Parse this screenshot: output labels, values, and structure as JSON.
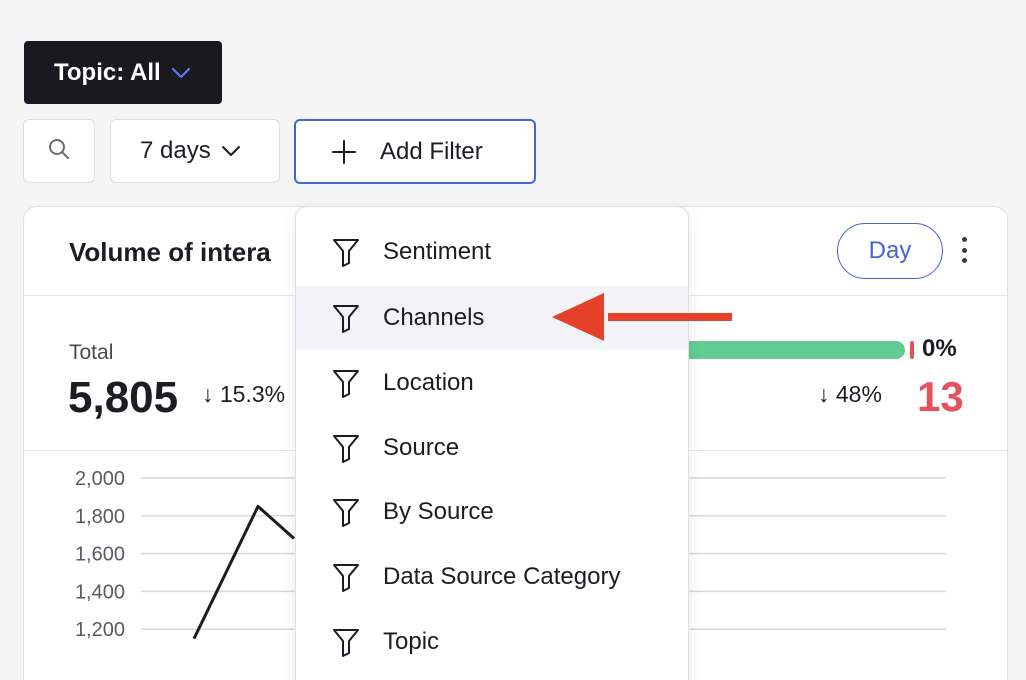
{
  "toolbar": {
    "topic_label": "Topic: All",
    "days_label": "7 days",
    "add_filter_label": "Add Filter"
  },
  "card": {
    "title": "Volume of intera",
    "period_button": "Day",
    "total_label": "Total",
    "total_value": "5,805",
    "total_change": "↓  15.3%",
    "sentiment_percent": "0%",
    "negative_change": "↓  48%",
    "negative_value": "13"
  },
  "filter_menu": {
    "items": [
      {
        "label": "Sentiment"
      },
      {
        "label": "Channels"
      },
      {
        "label": "Location"
      },
      {
        "label": "Source"
      },
      {
        "label": "By Source"
      },
      {
        "label": "Data Source Category"
      },
      {
        "label": "Topic"
      }
    ],
    "highlighted": "Channels"
  },
  "chart_data": {
    "type": "line",
    "y_ticks": [
      "2,000",
      "1,800",
      "1,600",
      "1,400",
      "1,200"
    ],
    "ylim": [
      1150,
      2000
    ],
    "series": [
      {
        "x": [
          0,
          1,
          2
        ],
        "values": [
          1150,
          1850,
          1680
        ]
      }
    ]
  },
  "colors": {
    "accent": "#4862d8",
    "positive": "#62cd93",
    "negative": "#e5525c",
    "arrow": "#e5402a"
  }
}
